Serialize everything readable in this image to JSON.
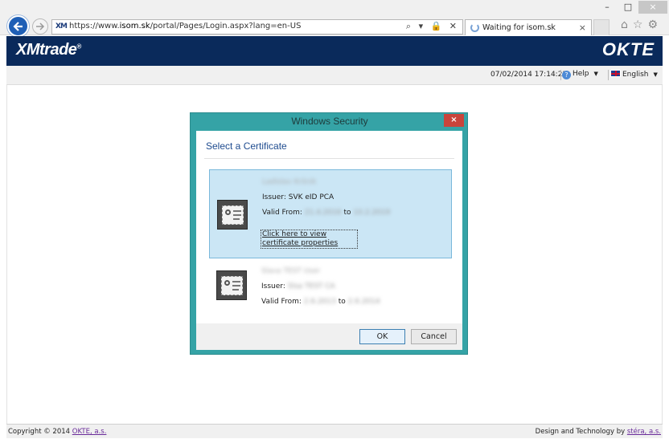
{
  "browser": {
    "url_prefix": "https://www.",
    "url_domain": "isom.sk",
    "url_path": "/portal/Pages/Login.aspx?lang=en-US",
    "favicon_text": "XM",
    "address_tools": "⌕ ▾ 🔒 ✕",
    "tab_title": "Waiting for isom.sk",
    "tab_close": "×",
    "window_controls": {
      "minimize": "–",
      "maximize": "□",
      "close": "×"
    },
    "right_tools": "⌂☆⚙"
  },
  "site": {
    "logo_left": "XMtrade",
    "logo_left_mark": "®",
    "logo_right": "OKTE",
    "timestamp": "07/02/2014 17:14:23",
    "help_label": "Help",
    "language_label": "English",
    "footer_left_prefix": "Copyright © 2014 ",
    "footer_left_link": "OKTE, a.s.",
    "footer_right_prefix": "Design and Technology by ",
    "footer_right_link": "stéra, a.s."
  },
  "dialog": {
    "title": "Windows Security",
    "close_label": "×",
    "heading": "Select a Certificate",
    "certificates": [
      {
        "name": "Ladislav Kršnik",
        "issuer_label": "Issuer:",
        "issuer": "SVK eID PCA",
        "valid_label": "Valid From:",
        "valid_from": "21.4.2016",
        "valid_to_label": "to",
        "valid_to": "10.2.2019",
        "link_text": "Click here to view certificate properties"
      },
      {
        "name": "Slava TEST User",
        "issuer_label": "Issuer:",
        "issuer": "Slsa TEST CA",
        "valid_label": "Valid From:",
        "valid_from": "2.6.2013",
        "valid_to_label": "to",
        "valid_to": "2.6.2014"
      }
    ],
    "ok_label": "OK",
    "cancel_label": "Cancel"
  },
  "colors": {
    "header_bg": "#0a2a5b",
    "dialog_frame": "#35a3a6",
    "selected_cert": "#cbe6f5",
    "close_red": "#c9443b"
  }
}
